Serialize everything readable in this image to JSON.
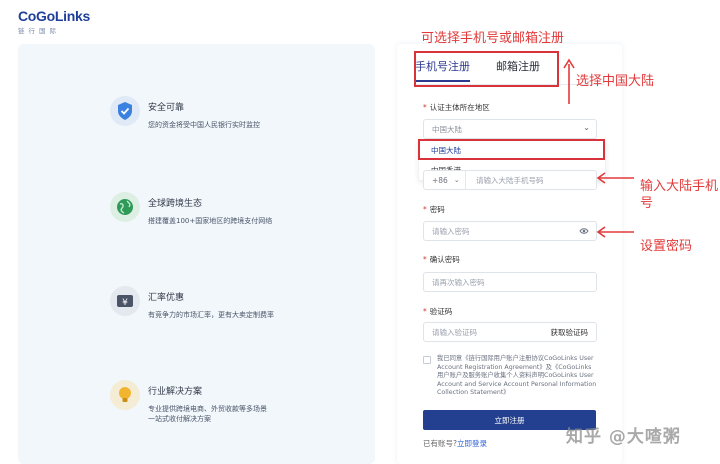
{
  "brand": {
    "name": "CoGoLinks",
    "sub": "链行国际"
  },
  "features": [
    {
      "title": "安全可靠",
      "desc": "您的资金将受中国人民银行实时监控",
      "icon": "shield-icon"
    },
    {
      "title": "全球跨境生态",
      "desc": "搭建覆盖100+国家地区的跨境支付网络",
      "icon": "globe-icon"
    },
    {
      "title": "汇率优惠",
      "desc": "有竞争力的市场汇率，更有大卖定制费率",
      "icon": "yen-ticket-icon"
    },
    {
      "title": "行业解决方案",
      "desc": "专业提供跨境电商、外贸收款等多场景",
      "desc2": "一站式收付解决方案",
      "icon": "lightbulb-icon"
    }
  ],
  "form": {
    "tabs": [
      "手机号注册",
      "邮箱注册"
    ],
    "region_label": "认证主体所在地区",
    "region_value": "中国大陆",
    "region_options": [
      "中国大陆",
      "中国香港"
    ],
    "phone_code": "+86",
    "phone_placeholder": "请输入大陆手机号码",
    "password_label": "密码",
    "password_placeholder": "请输入密码",
    "confirm_label": "确认密码",
    "confirm_placeholder": "请再次输入密码",
    "code_label": "验证码",
    "code_placeholder": "请输入验证码",
    "get_code": "获取验证码",
    "agreement": "我已同意《链行国际用户账户注册协议CoGoLinks User Account Registration Agreement》及《CoGoLinks用户账户及服务账户收集个人资料声明CoGoLinks User Account and Service Account Personal Information Collection Statement》",
    "submit": "立即注册",
    "have_account": "已有账号?",
    "login": "立即登录"
  },
  "annotations": {
    "top": "可选择手机号或邮箱注册",
    "region": "选择中国大陆",
    "phone_line1": "输入大陆手机",
    "phone_line2": "号",
    "password": "设置密码"
  },
  "watermark": "知乎 @大喳粥",
  "colors": {
    "primary": "#22408f",
    "annotation": "#e23a3a",
    "panel": "#f2f7fc"
  }
}
